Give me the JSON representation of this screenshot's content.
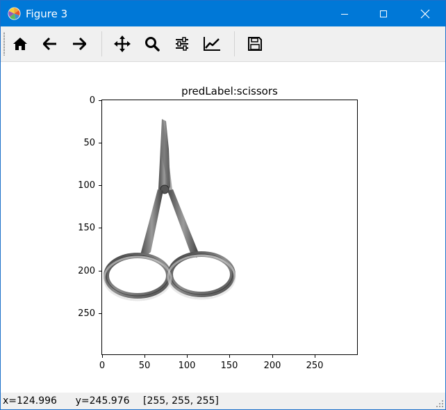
{
  "window": {
    "title": "Figure 3",
    "titlebar_color": "#0078d7",
    "minimize_icon": "minimize-icon",
    "maximize_icon": "maximize-icon",
    "close_icon": "close-icon"
  },
  "toolbar": {
    "items": [
      {
        "name": "home",
        "icon": "home-icon"
      },
      {
        "name": "back",
        "icon": "arrow-left-icon"
      },
      {
        "name": "forward",
        "icon": "arrow-right-icon"
      },
      {
        "name": "pan",
        "icon": "move-icon"
      },
      {
        "name": "zoom",
        "icon": "zoom-icon"
      },
      {
        "name": "configure-subplots",
        "icon": "sliders-icon"
      },
      {
        "name": "edit-axes",
        "icon": "chart-line-icon"
      },
      {
        "name": "save",
        "icon": "save-icon"
      }
    ]
  },
  "figure": {
    "title": "predLabel:scissors",
    "yticks": [
      "0",
      "50",
      "100",
      "150",
      "200",
      "250"
    ],
    "xticks": [
      "0",
      "50",
      "100",
      "150",
      "200",
      "250"
    ],
    "image_content": "scissors-photo"
  },
  "status": {
    "coords": "x=124.996      y=245.976",
    "pixel": "[255, 255, 255]"
  }
}
